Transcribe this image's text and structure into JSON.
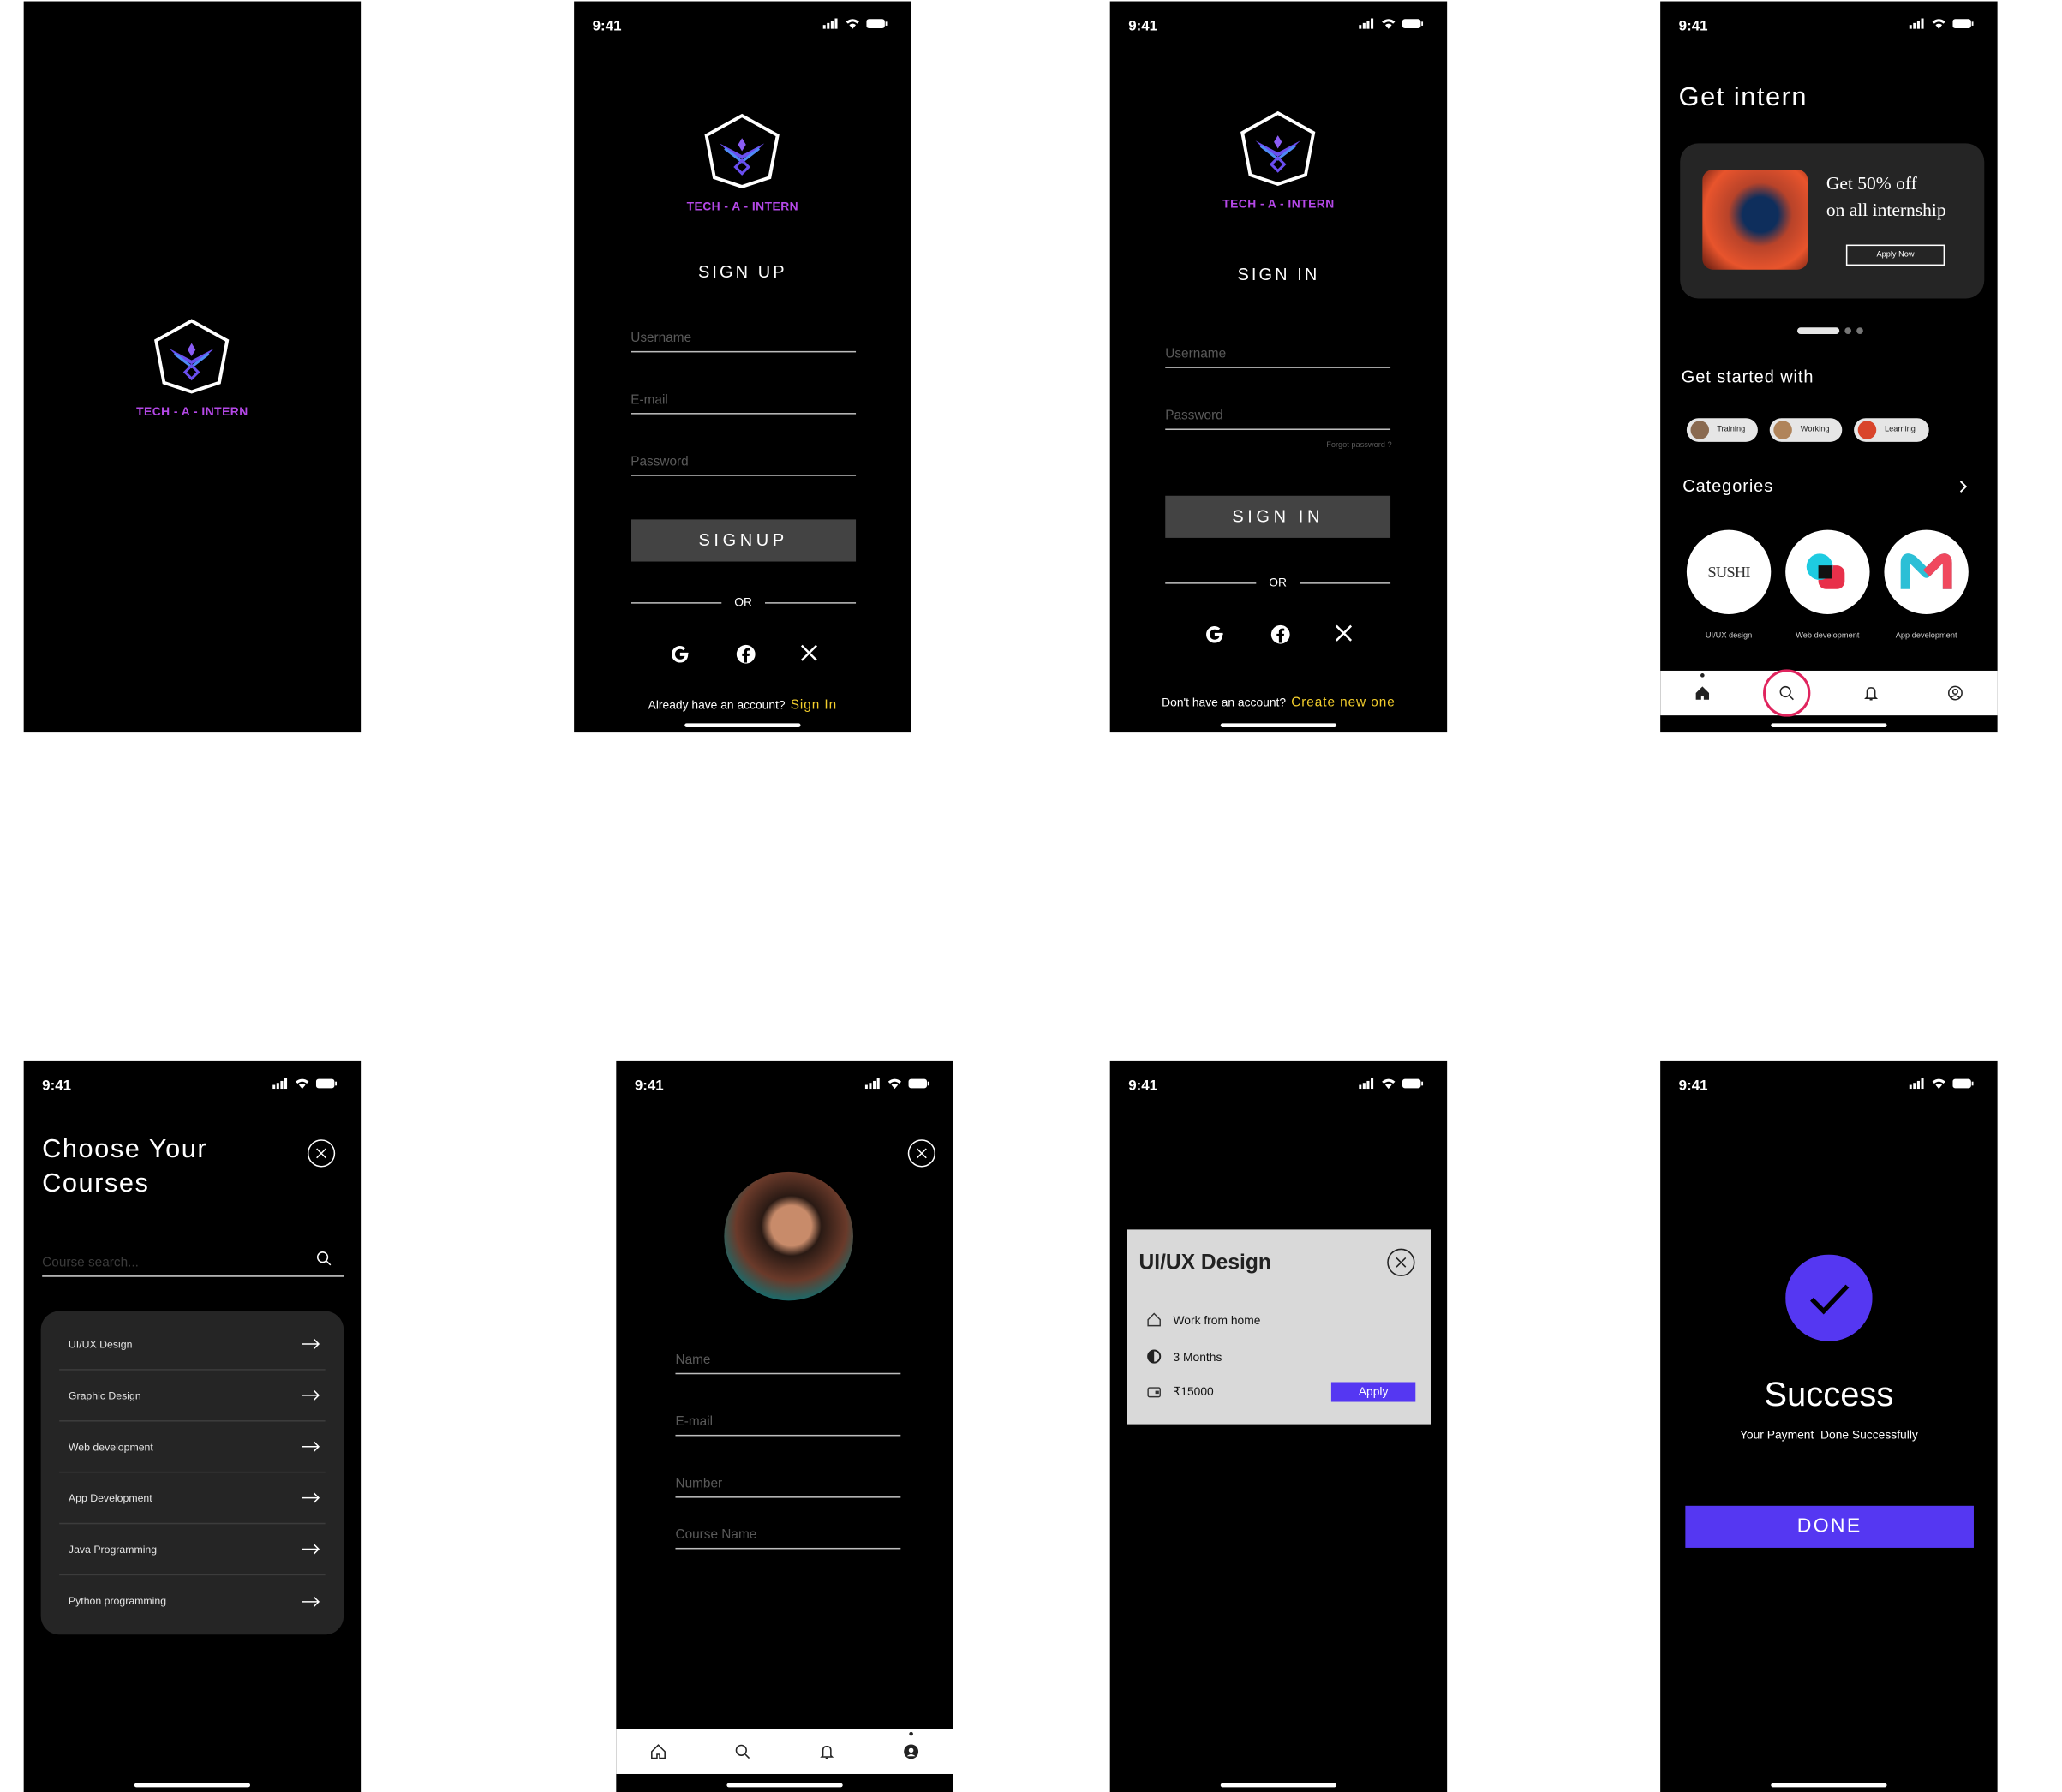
{
  "status": {
    "time": "9:41"
  },
  "brand": {
    "name": "TECH - A - INTERN"
  },
  "signup": {
    "title": "SIGN UP",
    "username_ph": "Username",
    "email_ph": "E-mail",
    "password_ph": "Password",
    "button": "SIGNUP",
    "or": "OR",
    "footer_text": "Already have an account?",
    "footer_link": "Sign In"
  },
  "signin": {
    "title": "SIGN IN",
    "username_ph": "Username",
    "password_ph": "Password",
    "forgot": "Forgot password ?",
    "button": "SIGN IN",
    "or": "OR",
    "footer_text": "Don't have an account?",
    "footer_link": "Create new one"
  },
  "home": {
    "title": "Get intern",
    "promo_line1": "Get 50% off",
    "promo_line2": "on all internship",
    "promo_button": "Apply  Now",
    "get_started": "Get started with",
    "chips": [
      "Training",
      "Working",
      "Learning"
    ],
    "categories_title": "Categories",
    "categories": [
      "UI/UX design",
      "Web development",
      "App development"
    ],
    "sushi_logo": "SUSHI"
  },
  "courses": {
    "title_line1": "Choose Your",
    "title_line2": "Courses",
    "search_ph": "Course search...",
    "items": [
      "UI/UX Design",
      "Graphic Design",
      "Web  development",
      "App Development",
      "Java Programming",
      "Python programming"
    ]
  },
  "profile": {
    "name_ph": "Name",
    "email_ph": "E-mail",
    "number_ph": "Number",
    "course_ph": "Course Name"
  },
  "detail": {
    "title": "UI/UX Design",
    "mode": "Work from home",
    "duration": "3 Months",
    "price": "₹15000",
    "apply": "Apply"
  },
  "success": {
    "title": "Success",
    "subtitle": "Your Payment  Done Successfully",
    "button": "DONE"
  },
  "colors": {
    "accent_purple": "#5537f2",
    "link_yellow": "#f4cf2c",
    "brand_magenta": "#b548e8",
    "highlight_red": "#e0245e"
  }
}
